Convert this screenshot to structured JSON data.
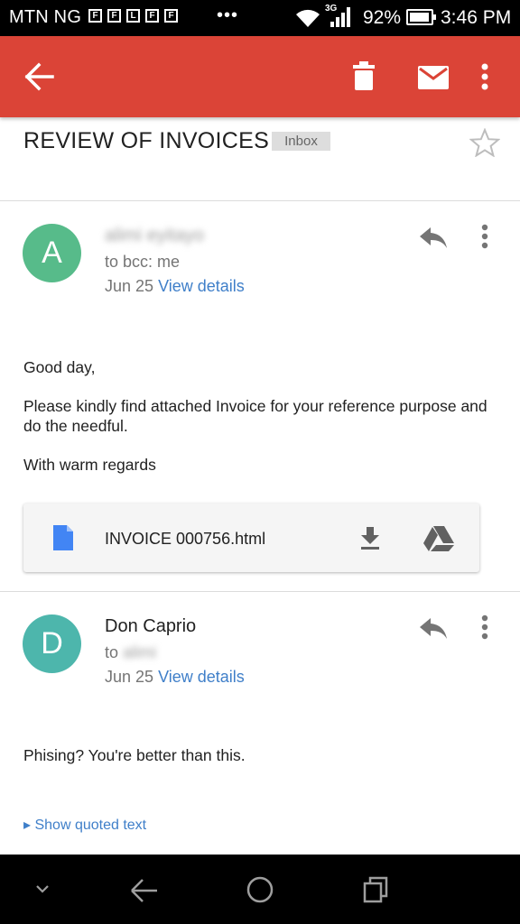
{
  "status_bar": {
    "carrier": "MTN NG",
    "notification_icons": [
      "F",
      "F",
      "L",
      "F",
      "F"
    ],
    "overflow": "•••",
    "network": "3G",
    "battery": "92%",
    "battery_level": 0.92,
    "time": "3:46 PM"
  },
  "toolbar": {
    "back_icon": "arrow-back-icon",
    "delete_icon": "trash-icon",
    "mark_unread_icon": "mail-icon",
    "menu_icon": "more-vert-icon",
    "color": "#db4437"
  },
  "thread": {
    "subject": "REVIEW OF INVOICES",
    "label": "Inbox"
  },
  "messages": [
    {
      "avatar_letter": "A",
      "avatar_color": "#57bb8a",
      "sender": "alimi eyitayo",
      "recipient_prefix": "to bcc: me",
      "date": "Jun 25",
      "view_details": "View details",
      "body": [
        "Good day,",
        "Please kindly find attached Invoice for your reference purpose and do the needful.",
        "With warm regards"
      ],
      "attachment": {
        "name": "INVOICE 000756.html"
      }
    },
    {
      "avatar_letter": "D",
      "avatar_color": "#4db6ac",
      "sender": "Don Caprio",
      "recipient_prefix": "to",
      "recipient": "alimi",
      "date": "Jun 25",
      "view_details": "View details",
      "body": [
        "Phising? You're better than this."
      ],
      "show_quoted": "▸ Show quoted text"
    }
  ]
}
